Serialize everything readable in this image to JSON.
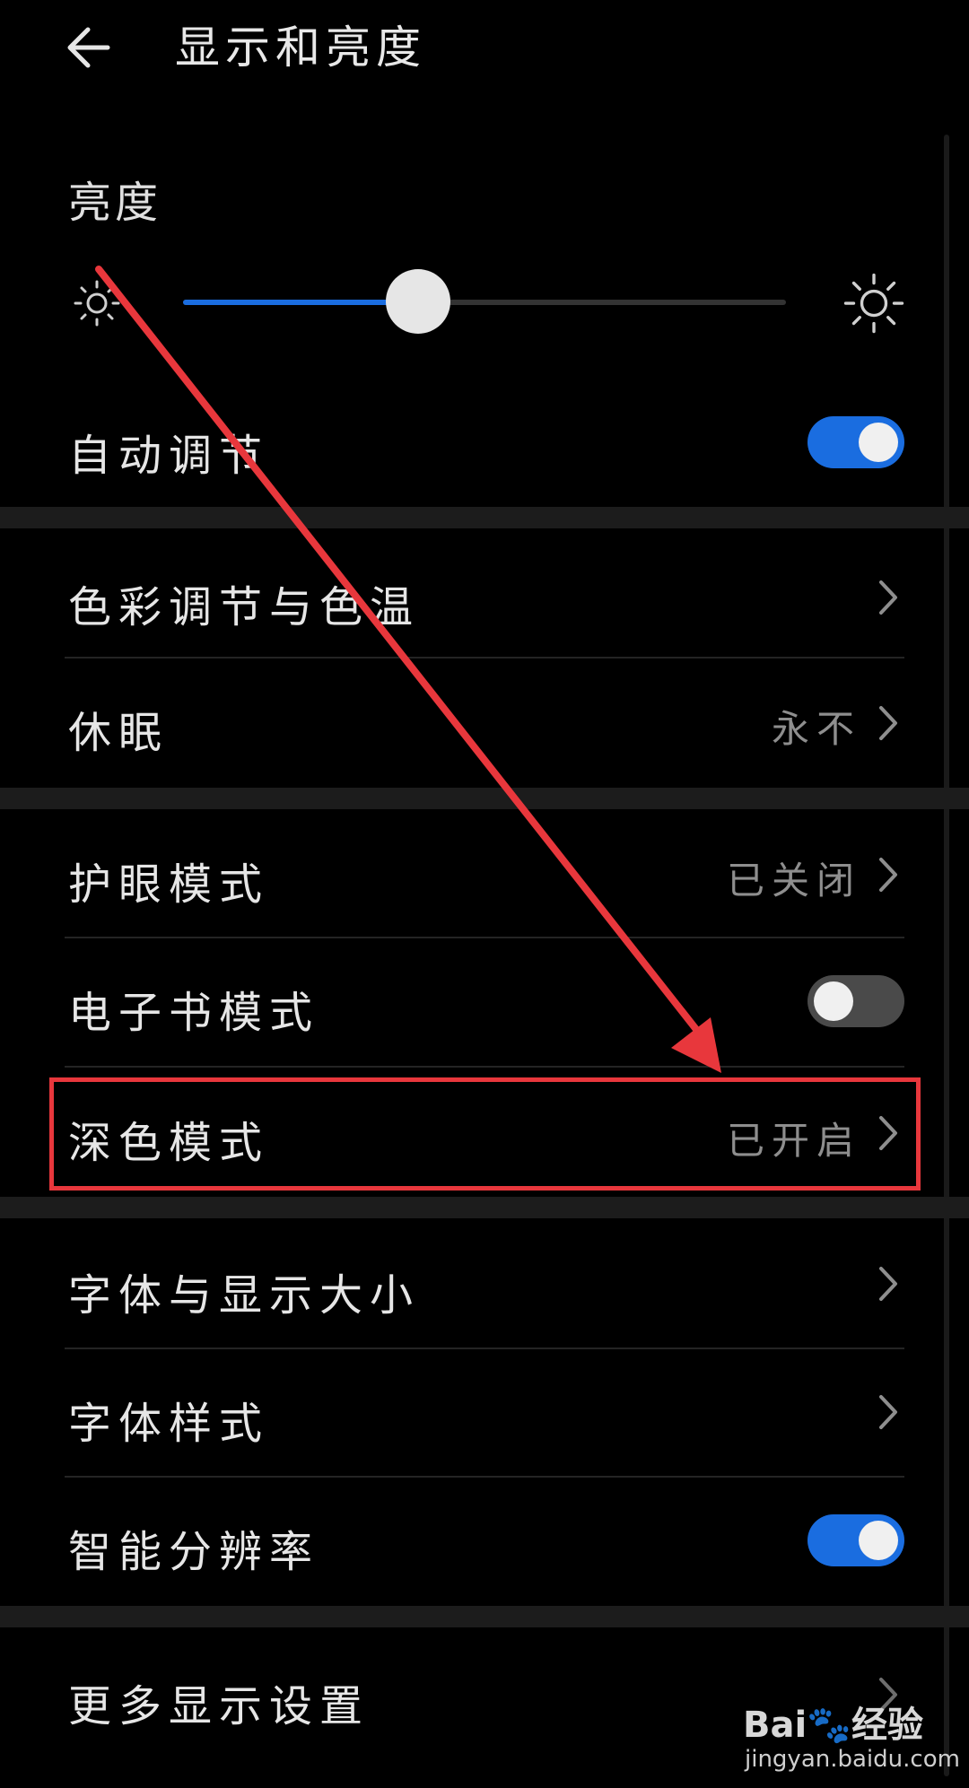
{
  "header": {
    "title": "显示和亮度",
    "back_icon": "back-arrow-icon"
  },
  "brightness": {
    "label": "亮度",
    "level_percent": 39,
    "accent_color": "#1a6de0"
  },
  "rows": {
    "auto_adjust": {
      "label": "自动调节",
      "toggle": true
    },
    "color_temp": {
      "label": "色彩调节与色温"
    },
    "sleep": {
      "label": "休眠",
      "value": "永不"
    },
    "eye_comfort": {
      "label": "护眼模式",
      "value": "已关闭"
    },
    "ebook": {
      "label": "电子书模式",
      "toggle": false
    },
    "dark_mode": {
      "label": "深色模式",
      "value": "已开启"
    },
    "font_size": {
      "label": "字体与显示大小"
    },
    "font_style": {
      "label": "字体样式"
    },
    "smart_resolution": {
      "label": "智能分辨率",
      "toggle": true
    },
    "more": {
      "label": "更多显示设置"
    }
  },
  "watermark": {
    "logo": "Bai🐾经验",
    "url": "jingyan.baidu.com"
  },
  "annotation": {
    "highlight_color": "#e8373c"
  }
}
